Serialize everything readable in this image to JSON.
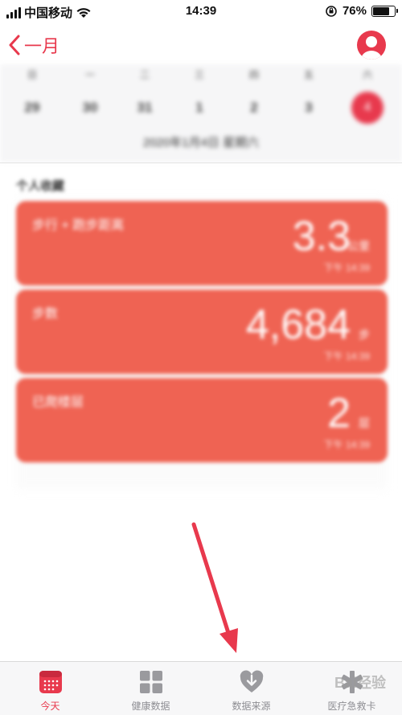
{
  "status_bar": {
    "carrier": "中国移动",
    "time": "14:39",
    "battery": "76%",
    "battery_level": 0.76
  },
  "nav": {
    "back_label": "一月"
  },
  "calendar": {
    "weekdays": [
      "日",
      "一",
      "二",
      "三",
      "四",
      "五",
      "六"
    ],
    "dates": [
      "29",
      "30",
      "31",
      "1",
      "2",
      "3",
      "4"
    ],
    "selected_index": 6,
    "selected_date_label": "2020年1月4日 星期六"
  },
  "favorites": {
    "title": "个人收藏",
    "cards": [
      {
        "title": "步行 + 跑步距离",
        "value": "3.3",
        "unit": "公里",
        "time": "下午 14:39"
      },
      {
        "title": "步数",
        "value": "4,684",
        "unit": "步",
        "time": "下午 14:39"
      },
      {
        "title": "已爬楼层",
        "value": "2",
        "unit": "层",
        "time": "下午 14:39"
      }
    ]
  },
  "tabs": [
    {
      "label": "今天",
      "icon": "calendar-icon",
      "active": true
    },
    {
      "label": "健康数据",
      "icon": "grid-icon",
      "active": false
    },
    {
      "label": "数据来源",
      "icon": "heart-download-icon",
      "active": false
    },
    {
      "label": "医疗急救卡",
      "icon": "medical-star-icon",
      "active": false
    }
  ],
  "colors": {
    "accent": "#e8394d",
    "card": "#ef6353",
    "annotation_arrow": "#e8394d"
  },
  "watermark": "Bai经验"
}
